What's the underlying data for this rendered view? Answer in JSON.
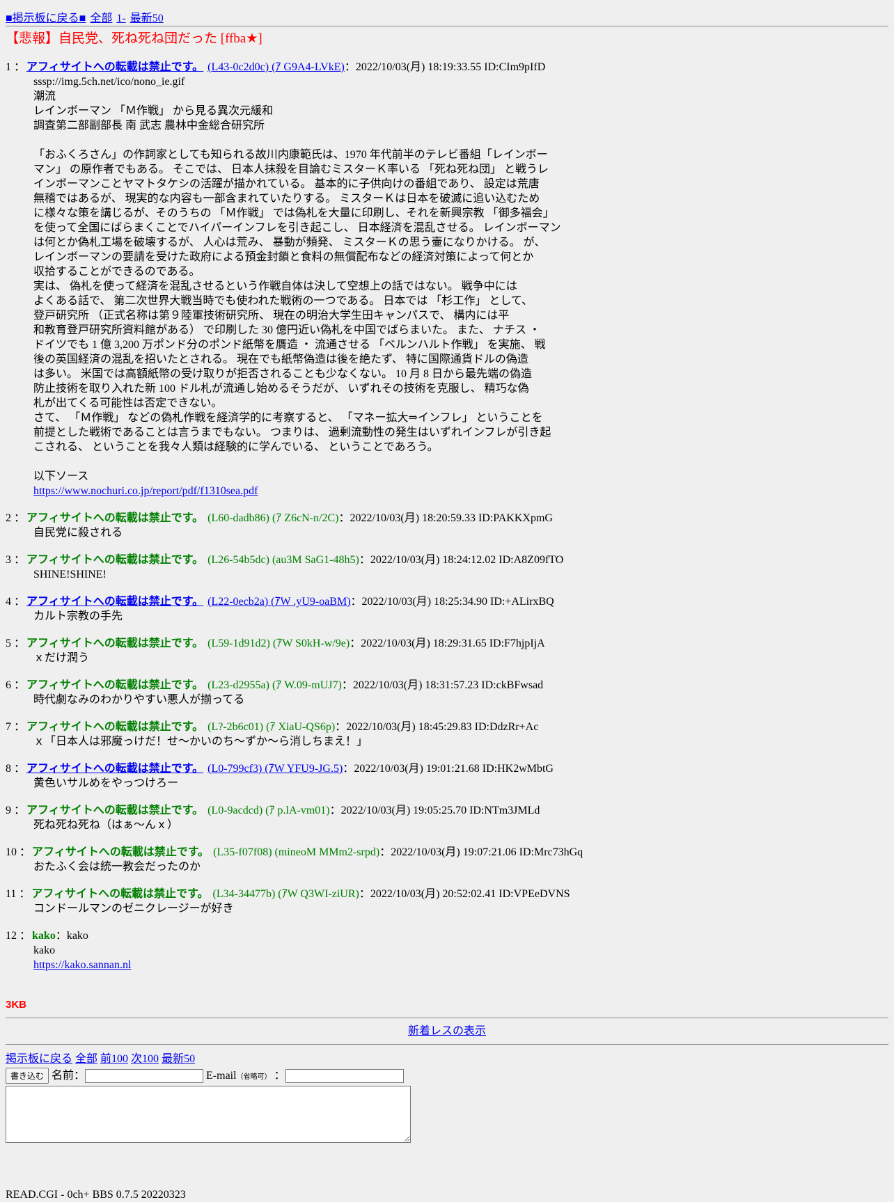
{
  "nav_top": {
    "back": "■掲示板に戻る■",
    "all": "全部",
    "first": "1-",
    "latest50": "最新50"
  },
  "thread_title": "【悲報】自民党、死ね死ね団だった [ffba★]",
  "post_name": "アフィサイトへの転載は禁止です。",
  "colon": "：",
  "posts": [
    {
      "num": "1",
      "name_link": true,
      "trip": "(L43-0c2d0c) (ｱ G9A4-LVkE)",
      "trip_link": true,
      "date": "2022/10/03(月) 18:19:33.55 ID:CIm9pIfD",
      "body": [
        "sssp://img.5ch.net/ico/nono_ie.gif",
        "潮流",
        "レインボーマン 「Ｍ作戦」 から見る異次元緩和",
        "調査第二部副部長 南 武志 農林中金総合研究所",
        "",
        "「おふくろさん」の作詞家としても知られる故川内康範氏は、1970 年代前半のテレビ番組「レインボー",
        "マン」 の原作者でもある。 そこでは、 日本人抹殺を目論むミスターＫ率いる 「死ね死ね団」 と戦うレ",
        "インボーマンことヤマトタケシの活躍が描かれている。 基本的に子供向けの番組であり、 設定は荒唐",
        "無稽ではあるが、 現実的な内容も一部含まれていたりする。 ミスターＫは日本を破滅に追い込むため",
        "に様々な策を講じるが、そのうちの 「Ｍ作戦」 では偽札を大量に印刷し、それを新興宗教 「御多福会」",
        "を使って全国にばらまくことでハイパーインフレを引き起こし、 日本経済を混乱させる。 レインボーマン",
        "は何とか偽札工場を破壊するが、 人心は荒み、 暴動が頻発、 ミスターＫの思う壷になりかける。 が、",
        "レインボーマンの要請を受けた政府による預金封鎖と食料の無償配布などの経済対策によって何とか",
        "収拾することができるのである。",
        "実は、 偽札を使って経済を混乱させるという作戦自体は決して空想上の話ではない。 戦争中には",
        "よくある話で、 第二次世界大戦当時でも使われた戦術の一つである。 日本では 「杉工作」 として、",
        "登戸研究所 （正式名称は第９陸軍技術研究所、 現在の明治大学生田キャンパスで、 構内には平",
        "和教育登戸研究所資料館がある） で印刷した 30 億円近い偽札を中国でばらまいた。 また、 ナチス ・",
        "ドイツでも 1 億 3,200 万ポンド分のポンド紙幣を贋造 ・ 流通させる 「ベルンハルト作戦」 を実施、 戦",
        "後の英国経済の混乱を招いたとされる。 現在でも紙幣偽造は後を絶たず、 特に国際通貨ドルの偽造",
        "は多い。 米国では高額紙幣の受け取りが拒否されることも少なくない。 10 月 8 日から最先端の偽造",
        "防止技術を取り入れた新 100 ドル札が流通し始めるそうだが、 いずれその技術を克服し、 精巧な偽",
        "札が出てくる可能性は否定できない。",
        "さて、 「Ｍ作戦」 などの偽札作戦を経済学的に考察すると、 「マネー拡大⇒インフレ」 ということを",
        "前提とした戦術であることは言うまでもない。 つまりは、 過剰流動性の発生はいずれインフレが引き起",
        "こされる、 ということを我々人類は経験的に学んでいる、 ということであろう。",
        "",
        "以下ソース"
      ],
      "link": "https://www.nochuri.co.jp/report/pdf/f1310sea.pdf"
    },
    {
      "num": "2",
      "trip": "(L60-dadb86) (ｱ Z6cN-n/2C)",
      "date": "2022/10/03(月) 18:20:59.33 ID:PAKKXpmG",
      "body": [
        "自民党に殺される"
      ]
    },
    {
      "num": "3",
      "trip": "(L26-54b5dc) (au3M SaG1-48h5)",
      "date": "2022/10/03(月) 18:24:12.02 ID:A8Z09fTO",
      "body": [
        "SHINE!SHINE!"
      ]
    },
    {
      "num": "4",
      "name_link": true,
      "trip": "(L22-0ecb2a) (ｱW .yU9-oaBM)",
      "trip_link": true,
      "date": "2022/10/03(月) 18:25:34.90 ID:+ALirxBQ",
      "body": [
        "カルト宗教の手先"
      ]
    },
    {
      "num": "5",
      "trip": "(L59-1d91d2) (ｱW S0kH-w/9e)",
      "date": "2022/10/03(月) 18:29:31.65 ID:F7hjpIjA",
      "body": [
        "ｘだけ潤う"
      ]
    },
    {
      "num": "6",
      "trip": "(L23-d2955a) (ｱ W.09-mUJ7)",
      "date": "2022/10/03(月) 18:31:57.23 ID:ckBFwsad",
      "body": [
        "時代劇なみのわかりやすい悪人が揃ってる"
      ]
    },
    {
      "num": "7",
      "trip": "(L?-2b6c01) (ｱ XiaU-QS6p)",
      "date": "2022/10/03(月) 18:45:29.83 ID:DdzRr+Ac",
      "body": [
        "ｘ「日本人は邪魔っけだ！せ～かいのち～ずか～ら消しちまえ！」"
      ]
    },
    {
      "num": "8",
      "name_link": true,
      "trip": "(L0-799cf3) (ｱW YFU9-JG.5)",
      "trip_link": true,
      "date": "2022/10/03(月) 19:01:21.68 ID:HK2wMbtG",
      "body": [
        "黄色いサルめをやっつけろー"
      ]
    },
    {
      "num": "9",
      "trip": "(L0-9acdcd) (ｱ p.lA-vm01)",
      "date": "2022/10/03(月) 19:05:25.70 ID:NTm3JMLd",
      "body": [
        "死ね死ね死ね（はぁ～んｘ）"
      ]
    },
    {
      "num": "10",
      "trip": "(L35-f07f08) (mineoM MMm2-srpd)",
      "date": "2022/10/03(月) 19:07:21.06 ID:Mrc73hGq",
      "body": [
        "おたふく会は統一教会だったのか"
      ]
    },
    {
      "num": "11",
      "trip": "(L34-34477b) (ｱW Q3WI-ziUR)",
      "date": "2022/10/03(月) 20:52:02.41 ID:VPEeDVNS",
      "body": [
        "コンドールマンのゼニクレージーが好き"
      ]
    },
    {
      "num": "12",
      "custom_name": "kako",
      "date": "kako",
      "body": [
        "kako"
      ],
      "link": "https://kako.sannan.nl"
    }
  ],
  "size_label": "3KB",
  "new_res_link": "新着レスの表示",
  "nav_bottom": {
    "back": "掲示板に戻る",
    "all": "全部",
    "prev100": "前100",
    "next100": "次100",
    "latest50": "最新50"
  },
  "form": {
    "submit": "書き込む",
    "name_label": "名前：",
    "email_label": "E-mail",
    "email_note": "（省略可）",
    "email_colon": "："
  },
  "footer": {
    "version": "READ.CGI - 0ch+ BBS 0.7.5 20220323"
  }
}
